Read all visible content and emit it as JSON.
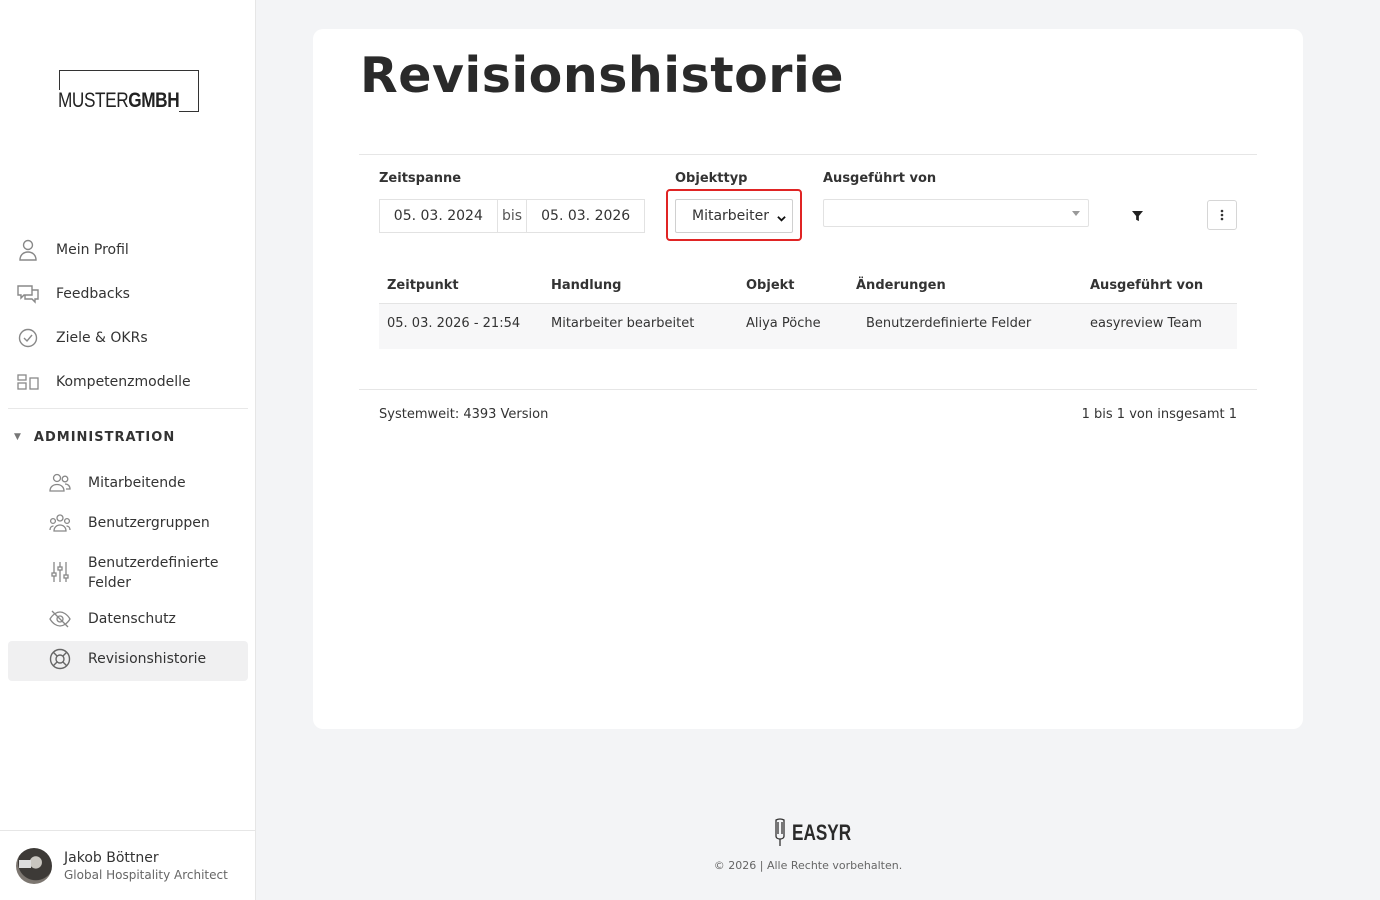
{
  "logo": {
    "part1": "MUSTER",
    "part2": "GMBH"
  },
  "nav": {
    "items": [
      {
        "label": "Mein Profil",
        "icon": "user-icon"
      },
      {
        "label": "Feedbacks",
        "icon": "chat-bubbles-icon"
      },
      {
        "label": "Ziele & OKRs",
        "icon": "check-circle-icon"
      },
      {
        "label": "Kompetenzmodelle",
        "icon": "model-blocks-icon"
      }
    ],
    "admin_label": "ADMINISTRATION",
    "admin_items": [
      {
        "label": "Mitarbeitende",
        "icon": "users-icon"
      },
      {
        "label": "Benutzergruppen",
        "icon": "user-group-icon"
      },
      {
        "label": "Benutzerdefinierte Felder",
        "icon": "sliders-icon"
      },
      {
        "label": "Datenschutz",
        "icon": "eye-off-icon"
      },
      {
        "label": "Revisionshistorie",
        "icon": "lifebuoy-icon",
        "active": true
      }
    ]
  },
  "user": {
    "name": "Jakob Böttner",
    "role": "Global Hospitality Architect"
  },
  "page": {
    "title": "Revisionshistorie"
  },
  "filters": {
    "timespan_label": "Zeitspanne",
    "date_from": "05. 03. 2024",
    "date_sep": "bis",
    "date_to": "05. 03. 2026",
    "objtype_label": "Objekttyp",
    "objtype_value": "Mitarbeiter",
    "executed_by_label": "Ausgeführt von",
    "executed_by_value": ""
  },
  "table": {
    "headers": [
      "Zeitpunkt",
      "Handlung",
      "Objekt",
      "Änderungen",
      "Ausgeführt von"
    ],
    "rows": [
      [
        "05. 03. 2026 - 21:54",
        "Mitarbeiter bearbeitet",
        "Aliya Pöche",
        "Benutzerdefinierte Felder",
        "easyreview Team"
      ]
    ]
  },
  "footer": {
    "systemwide": "Systemweit: 4393 Version",
    "pagination": "1 bis 1 von insgesamt 1"
  },
  "brand": {
    "name": "EASYR",
    "copyright": "© 2026 | Alle Rechte vorbehalten."
  },
  "colors": {
    "highlight": "#e02424",
    "active_bg": "#f0f0f1"
  }
}
